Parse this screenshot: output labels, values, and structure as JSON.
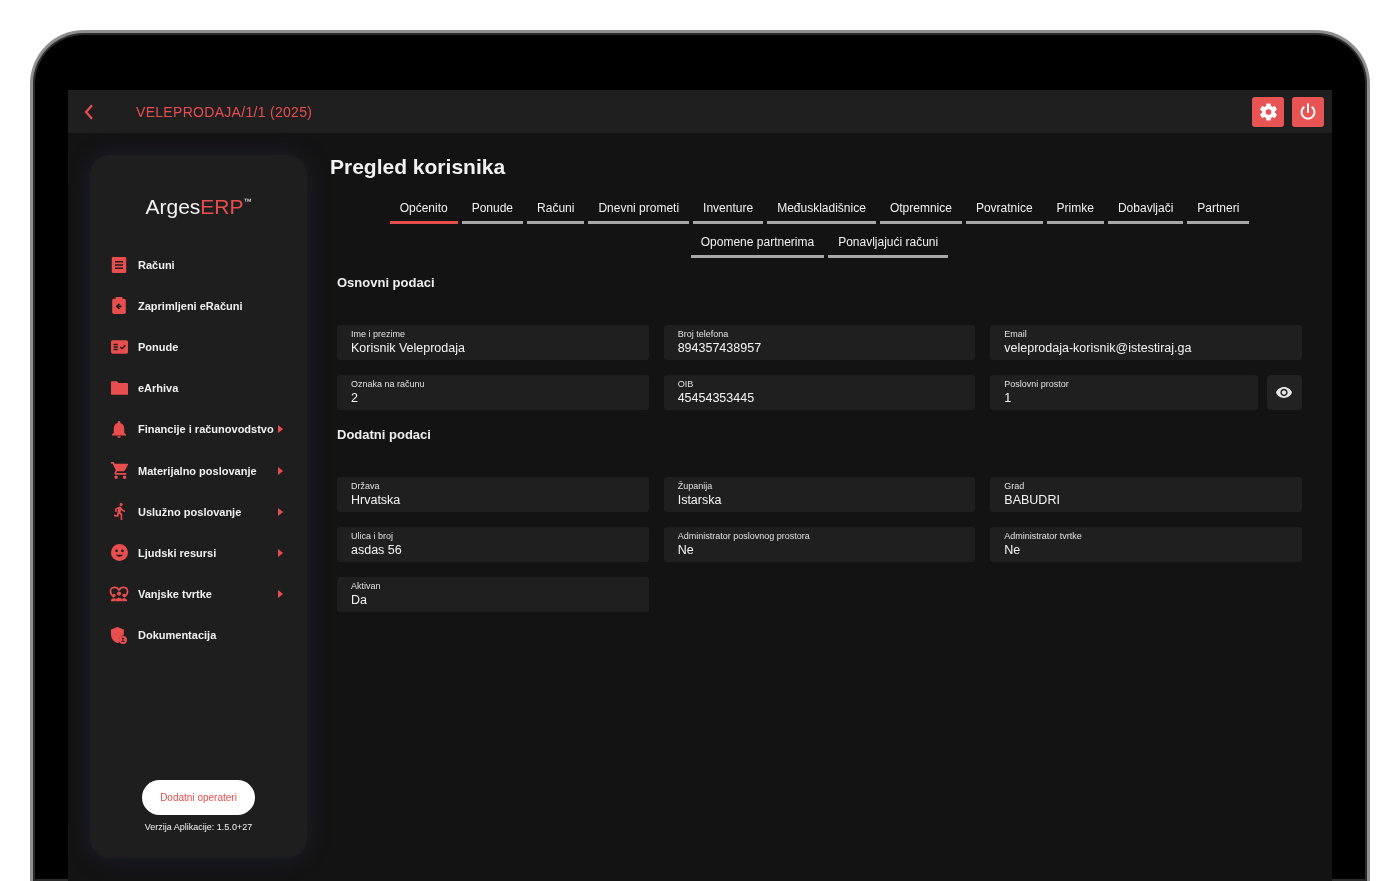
{
  "top_bar": {
    "title": "VELEPRODAJA/1/1 (2025)"
  },
  "sidebar": {
    "logo": {
      "name": "Arges",
      "accent": "ERP",
      "mark": "™"
    },
    "items": [
      {
        "label": "Računi",
        "expandable": false
      },
      {
        "label": "Zaprimljeni eRačuni",
        "expandable": false
      },
      {
        "label": "Ponude",
        "expandable": false
      },
      {
        "label": "eArhiva",
        "expandable": false
      },
      {
        "label": "Financije i računovodstvo",
        "expandable": true
      },
      {
        "label": "Materijalno poslovanje",
        "expandable": true
      },
      {
        "label": "Uslužno poslovanje",
        "expandable": true
      },
      {
        "label": "Ljudski resursi",
        "expandable": true
      },
      {
        "label": "Vanjske tvrtke",
        "expandable": true
      },
      {
        "label": "Dokumentacija",
        "expandable": false
      }
    ],
    "button": "Dodatni operateri",
    "version": "Verzija Aplikacije: 1.5.0+27"
  },
  "page": {
    "title": "Pregled korisnika",
    "tabs": [
      {
        "label": "Općenito",
        "selected": true
      },
      {
        "label": "Ponude",
        "selected": false
      },
      {
        "label": "Računi",
        "selected": false
      },
      {
        "label": "Dnevni prometi",
        "selected": false
      },
      {
        "label": "Inventure",
        "selected": false
      },
      {
        "label": "Međuskladišnice",
        "selected": false
      },
      {
        "label": "Otpremnice",
        "selected": false
      },
      {
        "label": "Povratnice",
        "selected": false
      },
      {
        "label": "Primke",
        "selected": false
      },
      {
        "label": "Dobavljači",
        "selected": false
      },
      {
        "label": "Partneri",
        "selected": false
      },
      {
        "label": "Opomene partnerima",
        "selected": false
      },
      {
        "label": "Ponavljajući računi",
        "selected": false
      }
    ],
    "sections": [
      {
        "title": "Osnovni podaci",
        "fields": [
          {
            "label": "Ime i prezime",
            "value": "Korisnik Veleprodaja",
            "kind": "text"
          },
          {
            "label": "Broj telefona",
            "value": "894357438957",
            "kind": "text"
          },
          {
            "label": "Email",
            "value": "veleprodaja-korisnik@istestiraj.ga",
            "kind": "text"
          },
          {
            "label": "Oznaka na računu",
            "value": "2",
            "kind": "text"
          },
          {
            "label": "OIB",
            "value": "45454353445",
            "kind": "text"
          },
          {
            "label": "Poslovni prostor",
            "value": "1",
            "kind": "reveal"
          }
        ]
      },
      {
        "title": "Dodatni podaci",
        "fields": [
          {
            "label": "Država",
            "value": "Hrvatska",
            "kind": "text"
          },
          {
            "label": "Županija",
            "value": "Istarska",
            "kind": "text"
          },
          {
            "label": "Grad",
            "value": "BABUDRI",
            "kind": "text"
          },
          {
            "label": "Ulica i broj",
            "value": "asdas 56",
            "kind": "text"
          },
          {
            "label": "Administrator poslovnog prostora",
            "value": "Ne",
            "kind": "text"
          },
          {
            "label": "Administrator tvrtke",
            "value": "Ne",
            "kind": "text"
          },
          {
            "label": "Aktivan",
            "value": "Da",
            "kind": "text"
          }
        ]
      }
    ]
  }
}
